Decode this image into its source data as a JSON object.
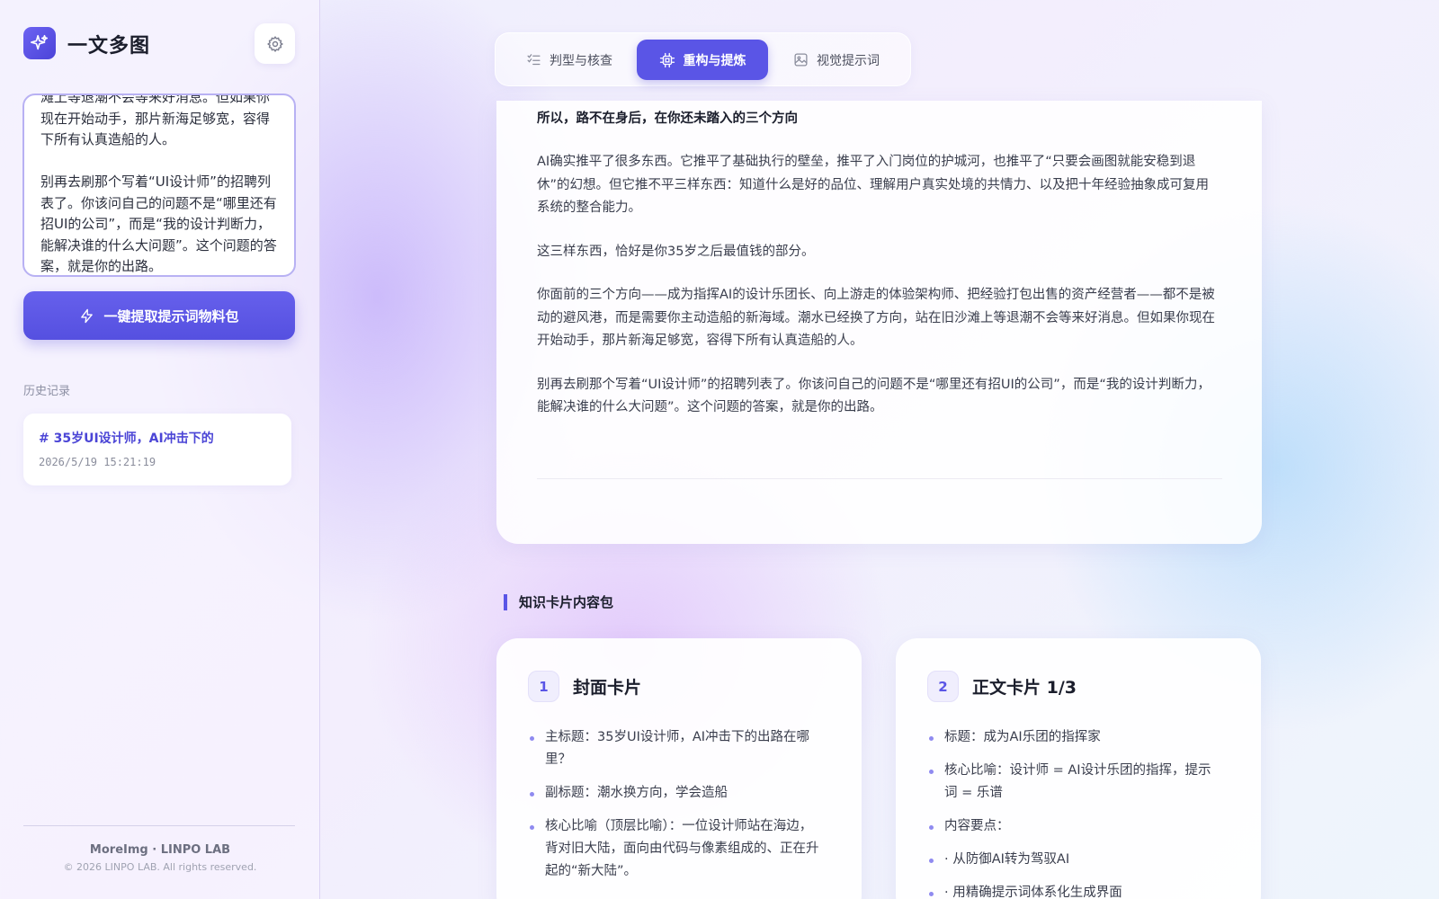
{
  "app": {
    "title": "一文多图"
  },
  "sidebar": {
    "settings_icon": "gear-icon",
    "source_text": "滩上等退潮不会等来好消息。但如果你现在开始动手，那片新海足够宽，容得下所有认真造船的人。\n\n别再去刷那个写着“UI设计师”的招聘列表了。你该问自己的问题不是“哪里还有招UI的公司”，而是“我的设计判断力，能解决谁的什么大问题”。这个问题的答案，就是你的出路。",
    "extract_button": "一键提取提示词物料包",
    "history_heading": "历史记录",
    "history": [
      {
        "title": "# 35岁UI设计师，AI冲击下的",
        "time": "2026/5/19 15:21:19"
      }
    ],
    "footer_brand": "MoreImg · LINPO LAB",
    "footer_copy": "© 2026 LINPO LAB. All rights reserved."
  },
  "tabs": [
    {
      "label": "判型与核查",
      "icon": "checklist-icon",
      "active": false
    },
    {
      "label": "重构与提炼",
      "icon": "cpu-icon",
      "active": true
    },
    {
      "label": "视觉提示词",
      "icon": "image-icon",
      "active": false
    }
  ],
  "article": {
    "heading": "所以，路不在身后，在你还未踏入的三个方向",
    "paragraphs": [
      "AI确实推平了很多东西。它推平了基础执行的壁垒，推平了入门岗位的护城河，也推平了“只要会画图就能安稳到退休”的幻想。但它推不平三样东西：知道什么是好的品位、理解用户真实处境的共情力、以及把十年经验抽象成可复用系统的整合能力。",
      "这三样东西，恰好是你35岁之后最值钱的部分。",
      "你面前的三个方向——成为指挥AI的设计乐团长、向上游走的体验架构师、把经验打包出售的资产经营者——都不是被动的避风港，而是需要你主动造船的新海域。潮水已经换了方向，站在旧沙滩上等退潮不会等来好消息。但如果你现在开始动手，那片新海足够宽，容得下所有认真造船的人。",
      "别再去刷那个写着“UI设计师”的招聘列表了。你该问自己的问题不是“哪里还有招UI的公司”，而是“我的设计判断力，能解决谁的什么大问题”。这个问题的答案，就是你的出路。"
    ]
  },
  "section": {
    "title": "知识卡片内容包"
  },
  "cards": [
    {
      "number": "1",
      "title": "封面卡片",
      "items": [
        "主标题：35岁UI设计师，AI冲击下的出路在哪里？",
        "副标题：潮水换方向，学会造船",
        "核心比喻（顶层比喻）：一位设计师站在海边，背对旧大陆，面向由代码与像素组成的、正在升起的“新大陆”。"
      ]
    },
    {
      "number": "2",
      "title": "正文卡片 1/3",
      "items": [
        "标题：成为AI乐团的指挥家",
        "核心比喻：设计师 = AI设计乐团的指挥，提示词 = 乐谱",
        "内容要点：",
        "· 从防御AI转为驾驭AI",
        "· 用精确提示词体系化生成界面"
      ]
    }
  ]
}
